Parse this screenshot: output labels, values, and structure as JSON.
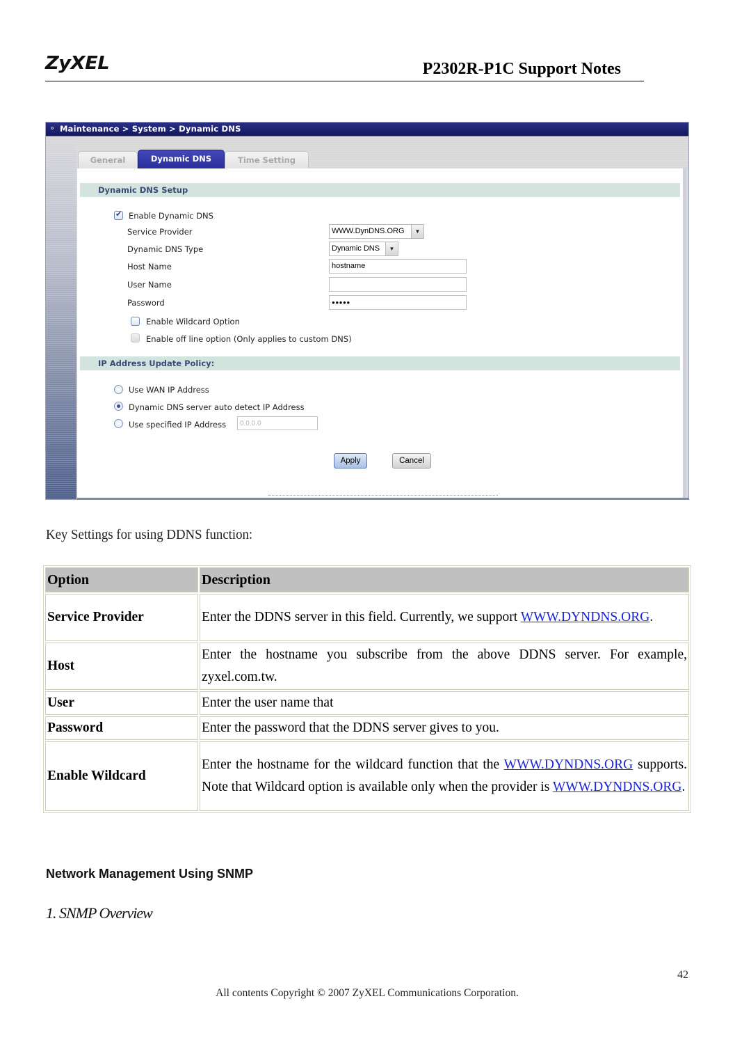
{
  "header": {
    "logo": "ZyXEL",
    "title": "P2302R-P1C Support Notes"
  },
  "screenshot": {
    "breadcrumb": "Maintenance > System > Dynamic DNS",
    "breadcrumb_icon": "double-chevron-right-icon",
    "tabs": [
      {
        "label": "General",
        "active": false
      },
      {
        "label": "Dynamic DNS",
        "active": true
      },
      {
        "label": "Time Setting",
        "active": false
      }
    ],
    "setup_section": {
      "title": "Dynamic DNS Setup",
      "enable_ddns": {
        "label": "Enable Dynamic DNS",
        "checked": true
      },
      "service_provider": {
        "label": "Service Provider",
        "value": "WWW.DynDNS.ORG"
      },
      "ddns_type": {
        "label": "Dynamic DNS Type",
        "value": "Dynamic DNS"
      },
      "host_name": {
        "label": "Host Name",
        "value": "hostname"
      },
      "user_name": {
        "label": "User Name",
        "value": ""
      },
      "password": {
        "label": "Password",
        "value": "●●●●●"
      },
      "wildcard": {
        "label": "Enable Wildcard Option",
        "checked": false
      },
      "offline": {
        "label": "Enable off line option (Only applies to custom DNS)",
        "checked": false,
        "disabled": true
      }
    },
    "policy_section": {
      "title": "IP Address Update Policy:",
      "options": [
        {
          "label": "Use WAN IP Address",
          "selected": false
        },
        {
          "label": "Dynamic DNS server auto detect IP Address",
          "selected": true
        },
        {
          "label": "Use specified IP Address",
          "selected": false
        }
      ],
      "specified_ip_value": "0.0.0.0"
    },
    "buttons": {
      "apply": "Apply",
      "cancel": "Cancel"
    }
  },
  "caption": "Key Settings for using DDNS function:",
  "table": {
    "headers": [
      "Option",
      "Description"
    ],
    "rows": [
      {
        "option": "Service Provider",
        "desc_before": "Enter the DDNS server in this field. Currently, we support ",
        "link": "WWW.DYNDNS.ORG",
        "desc_after": "."
      },
      {
        "option": "Host",
        "desc": "Enter the hostname you subscribe from the above DDNS server. For example, zyxel.com.tw."
      },
      {
        "option": "User",
        "desc": "Enter the user name that"
      },
      {
        "option": "Password",
        "desc": "Enter the password that the DDNS server gives to you."
      },
      {
        "option": "Enable Wildcard",
        "desc_before": "Enter the hostname for the wildcard function that the ",
        "link": "WWW.DYNDNS.ORG",
        "desc_middle": " supports. Note that Wildcard option is available only when the provider is ",
        "link2": "WWW.DYNDNS.ORG",
        "desc_after": "."
      }
    ]
  },
  "snmp": {
    "heading": "Network Management Using SNMP",
    "subheading": "1. SNMP Overview"
  },
  "footer": {
    "page_number": "42",
    "copyright": "All contents Copyright © 2007 ZyXEL Communications Corporation."
  },
  "colors": {
    "breadcrumb_bar": "#1b1f6e",
    "active_tab": "#2e32a0",
    "section_header_bg": "#d3e3de",
    "link": "#1a24d8",
    "table_header_bg": "#c0c0c0"
  }
}
